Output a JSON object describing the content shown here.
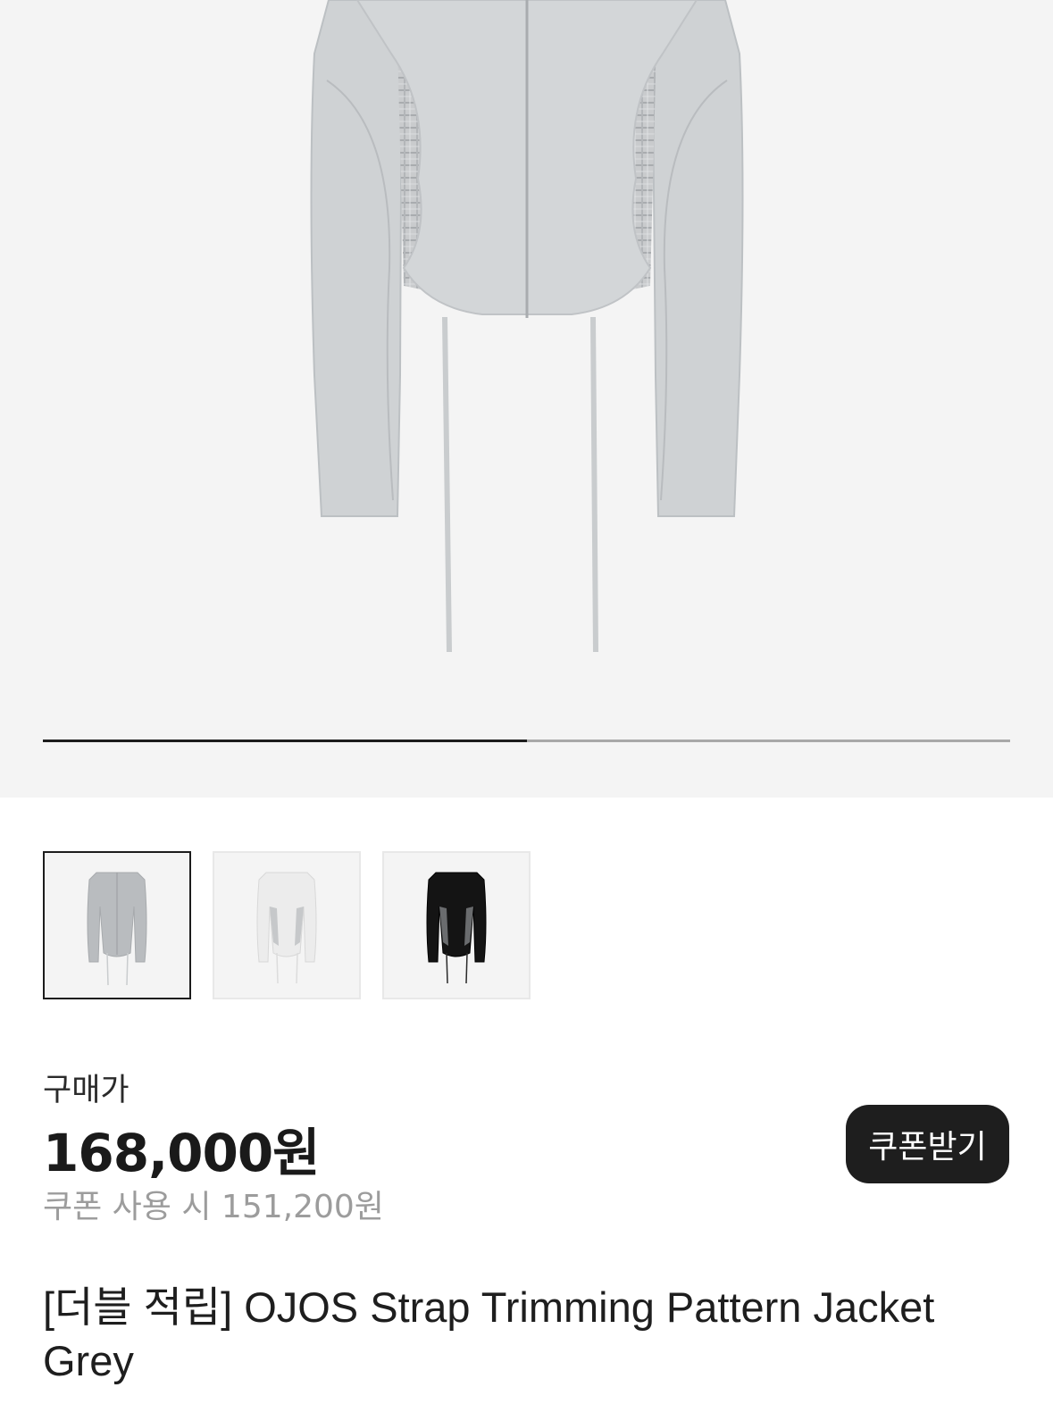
{
  "gallery": {
    "main_image": "product-photo-grey-jacket",
    "progress": 0.5,
    "progress_color": "#1c1c1c",
    "track_color": "#a8a8a8"
  },
  "thumbnails": [
    {
      "name": "thumb-grey",
      "color": "grey",
      "selected": true
    },
    {
      "name": "thumb-white",
      "color": "white",
      "selected": false
    },
    {
      "name": "thumb-black",
      "color": "black",
      "selected": false
    }
  ],
  "price": {
    "label": "구매가",
    "amount": "168,000원",
    "coupon_text": "쿠폰 사용 시 151,200원"
  },
  "coupon_button": {
    "label": "쿠폰받기",
    "color": "#1e1e1e"
  },
  "product": {
    "title": "[더블 적립] OJOS Strap Trimming Pattern Jacket Grey"
  }
}
